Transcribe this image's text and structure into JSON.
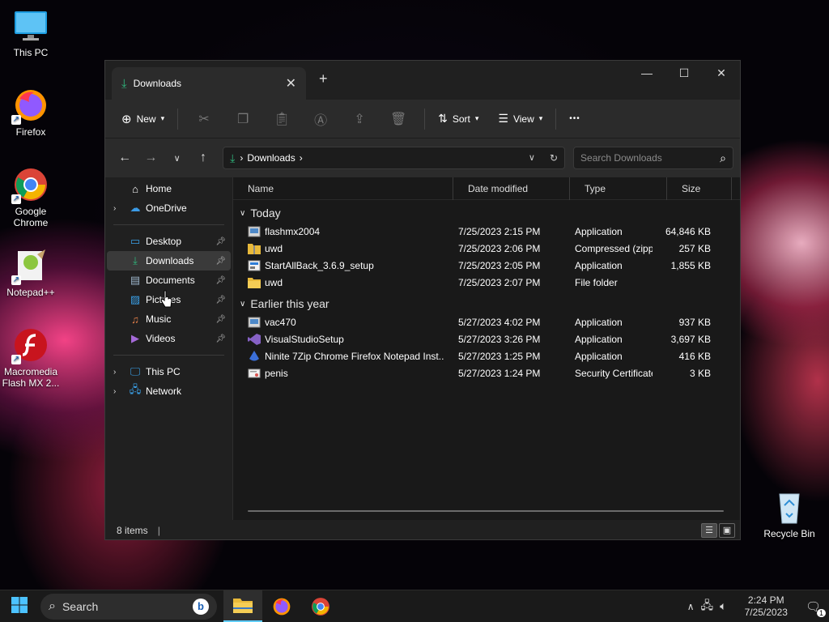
{
  "desktop": {
    "icons": [
      {
        "label": "This PC",
        "icon": "monitor-icon"
      },
      {
        "label": "Firefox",
        "icon": "firefox-icon"
      },
      {
        "label": "Google Chrome",
        "icon": "chrome-icon"
      },
      {
        "label": "Notepad++",
        "icon": "notepadpp-icon"
      },
      {
        "label": "Macromedia Flash MX 2...",
        "icon": "flash-icon"
      },
      {
        "label": "Recycle Bin",
        "icon": "recycle-bin-icon"
      }
    ]
  },
  "window": {
    "tab": {
      "label": "Downloads"
    },
    "controls": {
      "minimize": "—",
      "maximize": "☐",
      "close": "✕"
    },
    "commandbar": {
      "new_label": "New",
      "sort_label": "Sort",
      "view_label": "View",
      "more_label": "•••"
    },
    "address": {
      "crumb": "Downloads"
    },
    "search": {
      "placeholder": "Search Downloads"
    },
    "nav": {
      "items": [
        {
          "label": "Home"
        },
        {
          "label": "OneDrive"
        },
        {
          "label": "Desktop"
        },
        {
          "label": "Downloads"
        },
        {
          "label": "Documents"
        },
        {
          "label": "Pictures"
        },
        {
          "label": "Music"
        },
        {
          "label": "Videos"
        },
        {
          "label": "This PC"
        },
        {
          "label": "Network"
        }
      ]
    },
    "columns": {
      "name": "Name",
      "date": "Date modified",
      "type": "Type",
      "size": "Size"
    },
    "groups": [
      {
        "label": "Today",
        "files": [
          {
            "name": "flashmx2004",
            "date": "7/25/2023 2:15 PM",
            "type": "Application",
            "size": "64,846 KB",
            "icon": "installer-icon"
          },
          {
            "name": "uwd",
            "date": "7/25/2023 2:06 PM",
            "type": "Compressed (zipp...",
            "size": "257 KB",
            "icon": "zip-folder-icon"
          },
          {
            "name": "StartAllBack_3.6.9_setup",
            "date": "7/25/2023 2:05 PM",
            "type": "Application",
            "size": "1,855 KB",
            "icon": "setup-icon"
          },
          {
            "name": "uwd",
            "date": "7/25/2023 2:07 PM",
            "type": "File folder",
            "size": "",
            "icon": "folder-icon"
          }
        ]
      },
      {
        "label": "Earlier this year",
        "files": [
          {
            "name": "vac470",
            "date": "5/27/2023 4:02 PM",
            "type": "Application",
            "size": "937 KB",
            "icon": "installer-icon"
          },
          {
            "name": "VisualStudioSetup",
            "date": "5/27/2023 3:26 PM",
            "type": "Application",
            "size": "3,697 KB",
            "icon": "visual-studio-icon"
          },
          {
            "name": "Ninite 7Zip Chrome Firefox Notepad Inst...",
            "date": "5/27/2023 1:25 PM",
            "type": "Application",
            "size": "416 KB",
            "icon": "ninite-icon"
          },
          {
            "name": "penis",
            "date": "5/27/2023 1:24 PM",
            "type": "Security Certificate",
            "size": "3 KB",
            "icon": "certificate-icon"
          }
        ]
      }
    ],
    "status": {
      "count": "8 items"
    }
  },
  "taskbar": {
    "search_label": "Search",
    "clock_time": "2:24 PM",
    "clock_date": "7/25/2023",
    "notification_count": "1"
  },
  "colors": {
    "accent": "#60cdff",
    "folder": "#e8b93a",
    "downloads": "#2fb67c"
  }
}
